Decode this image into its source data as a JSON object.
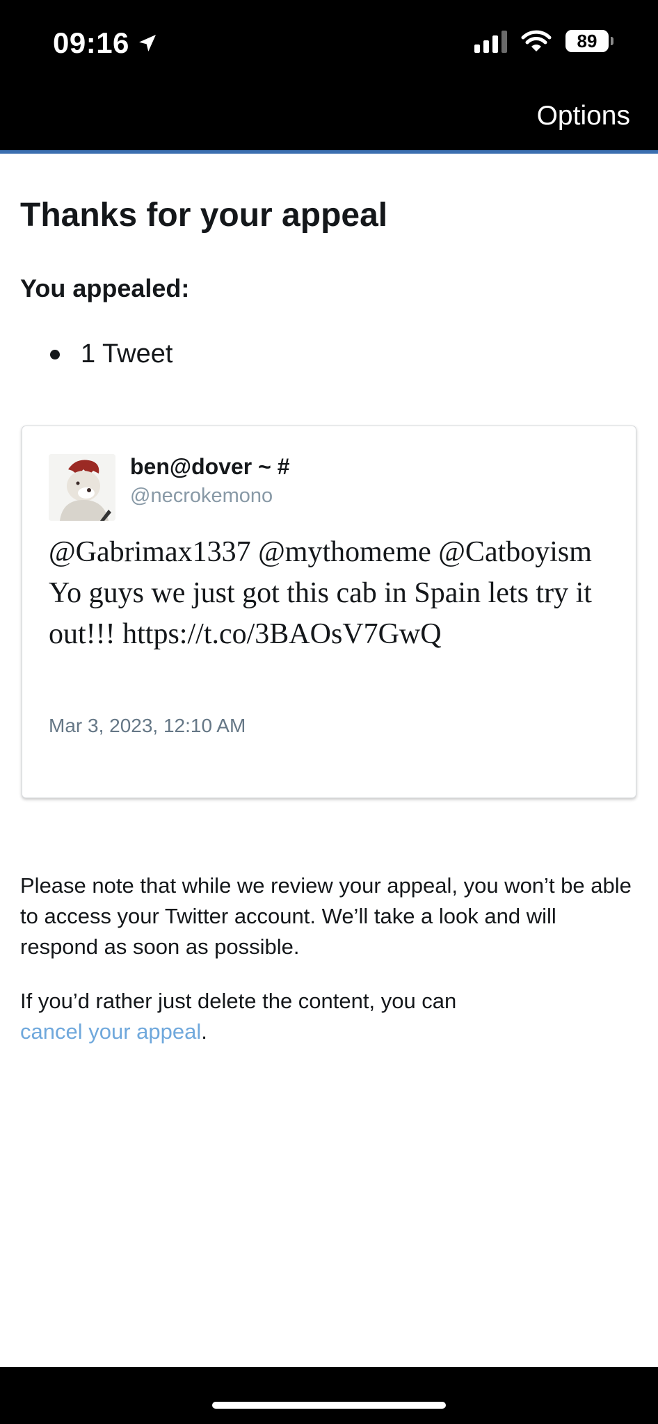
{
  "status_bar": {
    "time": "09:16",
    "battery": "89",
    "icons": [
      "location-arrow-icon",
      "cellular-signal-icon",
      "wifi-icon",
      "battery-icon"
    ]
  },
  "header": {
    "options_label": "Options"
  },
  "colors": {
    "header_background": "#000000",
    "header_accent_line": "#3b6fb0",
    "link": "#6fa8dc",
    "handle": "#8899a6"
  },
  "page": {
    "title": "Thanks for your appeal",
    "appealed_heading": "You appealed:",
    "appealed_items": [
      "1 Tweet"
    ]
  },
  "tweet": {
    "author_name": "ben@dover ~ #",
    "author_handle": "@necrokemono",
    "text": "@Gabrimax1337 @mythomeme @Catboyism Yo guys we just got this cab in Spain lets try it out!!! https://t.co/3BAOsV7GwQ",
    "date": "Mar 3, 2023, 12:10 AM"
  },
  "notice": {
    "review_text": "Please note that while we review your appeal, you won’t be able to access your Twitter account. We’ll take a look and will respond as soon as possible.",
    "delete_prefix": "If you’d rather just delete the content, you can",
    "cancel_link_label": "cancel your appeal",
    "delete_suffix": "."
  }
}
